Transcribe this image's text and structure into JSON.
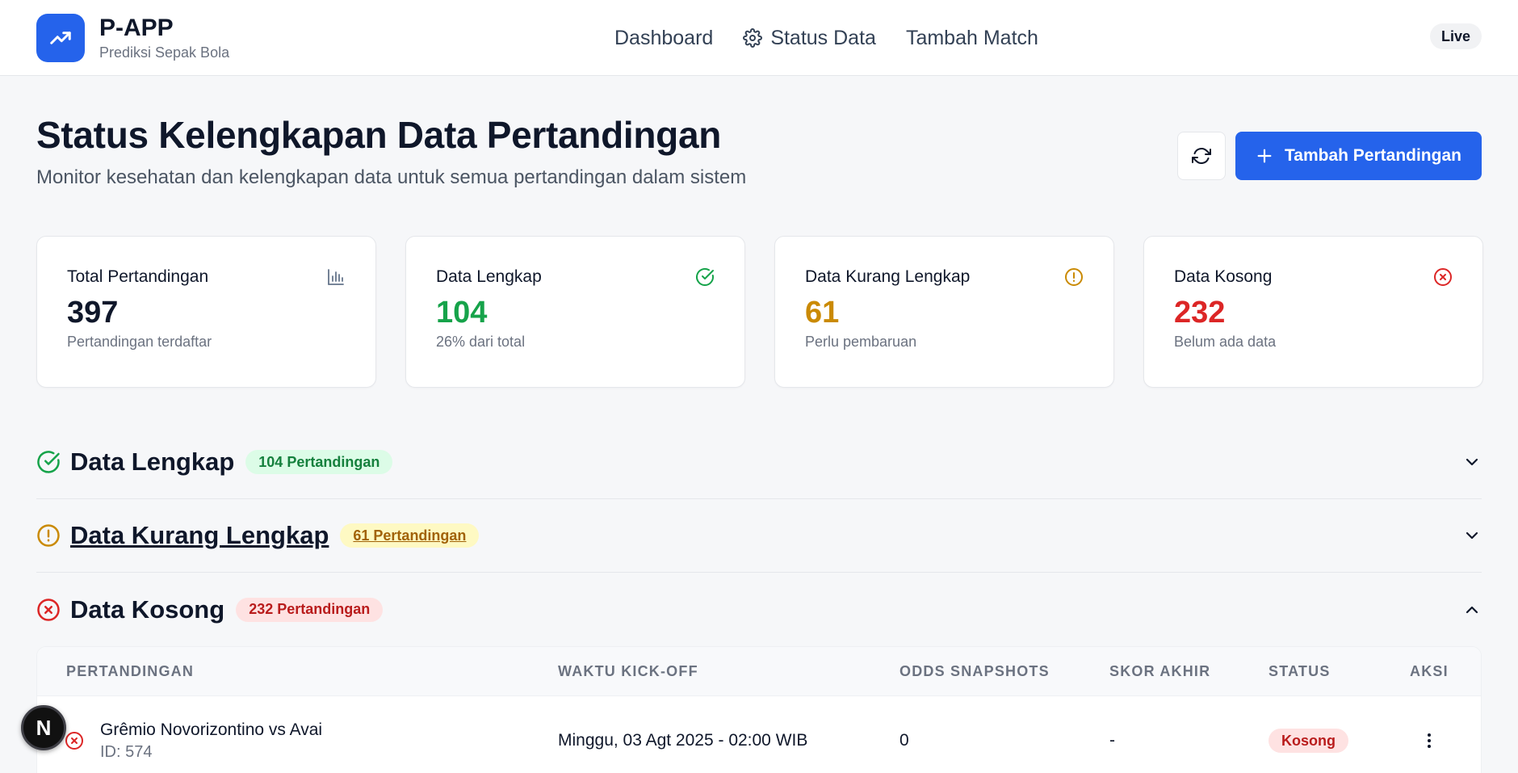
{
  "header": {
    "brand_title": "P-APP",
    "brand_subtitle": "Prediksi Sepak Bola",
    "nav": [
      {
        "label": "Dashboard",
        "icon": "none"
      },
      {
        "label": "Status Data",
        "icon": "gear-icon"
      },
      {
        "label": "Tambah Match",
        "icon": "none"
      }
    ],
    "live_label": "Live"
  },
  "page": {
    "title": "Status Kelengkapan Data Pertandingan",
    "subtitle": "Monitor kesehatan dan kelengkapan data untuk semua pertandingan dalam sistem",
    "refresh_icon": "refresh-icon",
    "add_button_label": "Tambah Pertandingan"
  },
  "stats": [
    {
      "label": "Total Pertandingan",
      "value": "397",
      "note": "Pertandingan terdaftar",
      "icon": "bar-chart-icon",
      "color": "#0f172a"
    },
    {
      "label": "Data Lengkap",
      "value": "104",
      "note": "26% dari total",
      "icon": "check-circle-icon",
      "color": "#16a34a"
    },
    {
      "label": "Data Kurang Lengkap",
      "value": "61",
      "note": "Perlu pembaruan",
      "icon": "alert-circle-icon",
      "color": "#ca8a04"
    },
    {
      "label": "Data Kosong",
      "value": "232",
      "note": "Belum ada data",
      "icon": "x-circle-icon",
      "color": "#dc2626"
    }
  ],
  "sections": [
    {
      "title": "Data Lengkap",
      "badge": "104 Pertandingan",
      "state": "collapsed"
    },
    {
      "title": "Data Kurang Lengkap",
      "badge": "61 Pertandingan",
      "state": "collapsed"
    },
    {
      "title": "Data Kosong",
      "badge": "232 Pertandingan",
      "state": "expanded"
    }
  ],
  "table": {
    "columns": [
      "PERTANDINGAN",
      "WAKTU KICK-OFF",
      "ODDS SNAPSHOTS",
      "SKOR AKHIR",
      "STATUS",
      "AKSI"
    ],
    "rows": [
      {
        "match": "Grêmio Novorizontino vs Avai",
        "id": "ID: 574",
        "kickoff": "Minggu, 03 Agt 2025 - 02:00 WIB",
        "odds": "0",
        "score": "-",
        "status": "Kosong"
      }
    ]
  },
  "floating": {
    "avatar_letter": "N"
  },
  "colors": {
    "accent": "#2563eb",
    "success": "#16a34a",
    "warning": "#ca8a04",
    "danger": "#dc2626"
  }
}
